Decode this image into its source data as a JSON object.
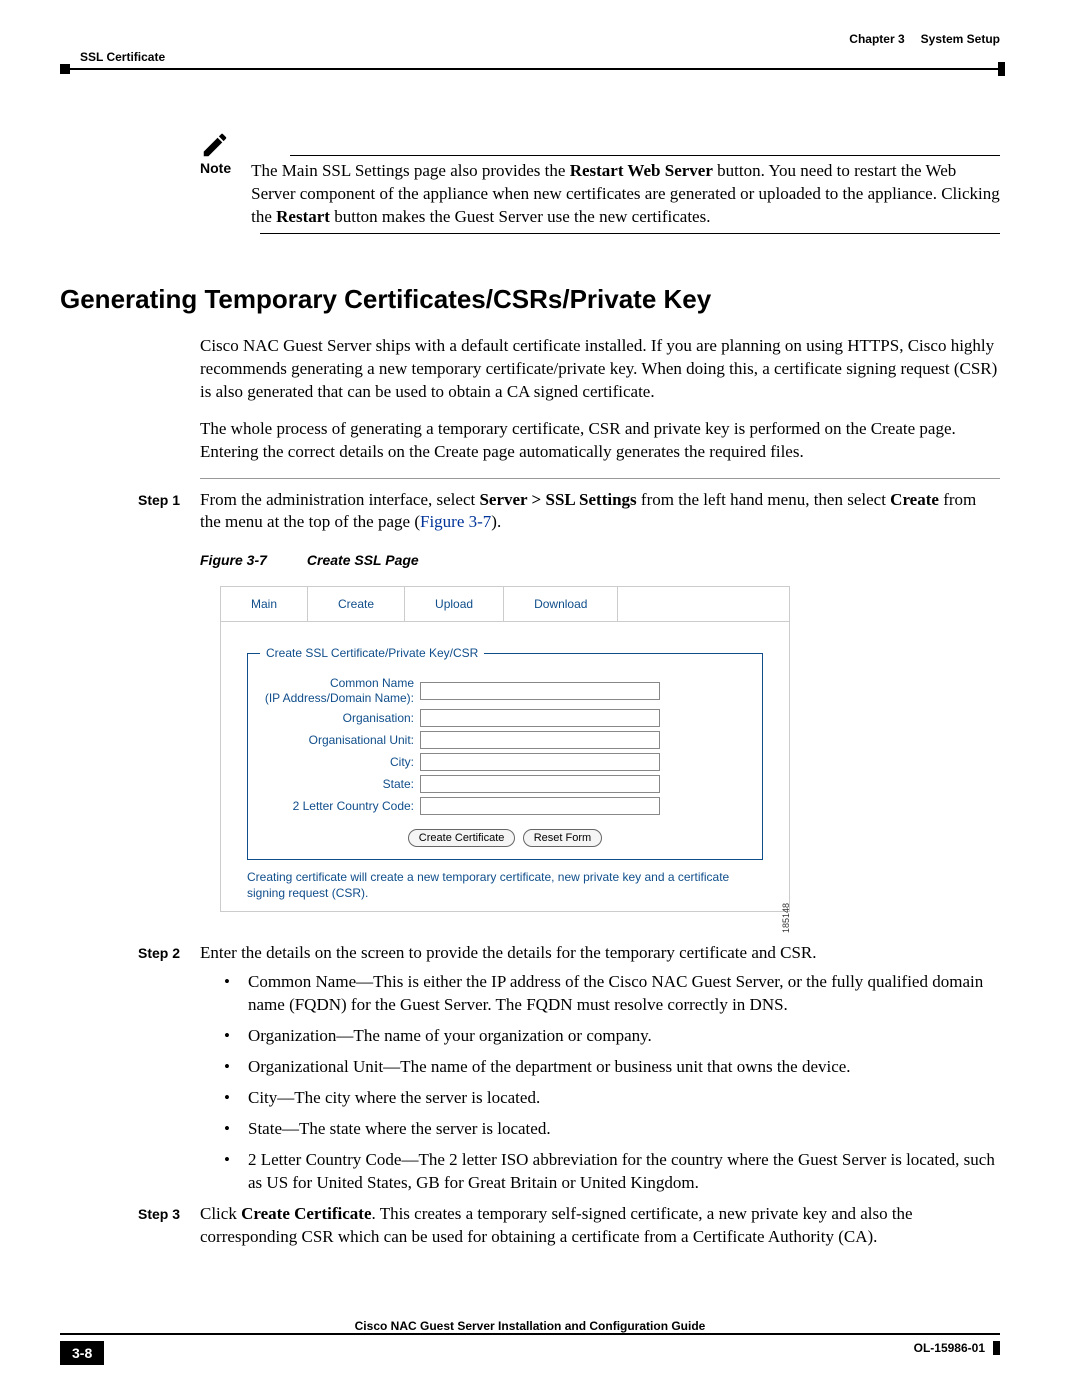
{
  "header": {
    "left": "SSL Certificate",
    "chapter": "Chapter 3",
    "chapter_title": "System Setup"
  },
  "note": {
    "label": "Note",
    "text_pre": "The Main SSL Settings page also provides the ",
    "bold1": "Restart Web Server",
    "text_mid": " button. You need to restart the Web Server component of the appliance when new certificates are generated or uploaded to the appliance. Clicking the ",
    "bold2": "Restart",
    "text_post": " button makes the Guest Server use the new certificates."
  },
  "h2": "Generating Temporary Certificates/CSRs/Private Key",
  "para1": "Cisco NAC Guest Server ships with a default certificate installed. If you are planning on using HTTPS, Cisco highly recommends generating a new temporary certificate/private key. When doing this, a certificate signing request (CSR) is also generated that can be used to obtain a CA signed certificate.",
  "para2": "The whole process of generating a temporary certificate, CSR and private key is performed on the Create page. Entering the correct details on the Create page automatically generates the required files.",
  "step1": {
    "label": "Step 1",
    "pre": "From the administration interface, select ",
    "bold1": "Server > SSL Settings",
    "mid": " from the left hand menu, then select ",
    "bold2": "Create",
    "mid2": " from the menu at the top of the page (",
    "link": "Figure 3-7",
    "post": ")."
  },
  "fig": {
    "num": "Figure 3-7",
    "title": "Create SSL Page",
    "id": "185148",
    "tabs": [
      "Main",
      "Create",
      "Upload",
      "Download"
    ],
    "legend": "Create SSL Certificate/Private Key/CSR",
    "labels": {
      "common": "Common Name",
      "common_sub": "(IP Address/Domain Name):",
      "org": "Organisation:",
      "ou": "Organisational Unit:",
      "city": "City:",
      "state": "State:",
      "cc": "2 Letter Country Code:"
    },
    "btn1": "Create Certificate",
    "btn2": "Reset Form",
    "note": "Creating certificate will create a new temporary certificate, new private key and a certificate signing request (CSR)."
  },
  "step2": {
    "label": "Step 2",
    "text": "Enter the details on the screen to provide the details for the temporary certificate and CSR."
  },
  "bullets": [
    "Common Name—This is either the IP address of the Cisco NAC Guest Server, or the fully qualified domain name (FQDN) for the Guest Server. The FQDN must resolve correctly in DNS.",
    "Organization—The name of your organization or company.",
    "Organizational Unit—The name of the department or business unit that owns the device.",
    "City—The city where the server is located.",
    "State—The state where the server is located.",
    "2 Letter Country Code—The 2 letter ISO abbreviation for the country where the Guest Server is located, such as US for United States, GB for Great Britain or United Kingdom."
  ],
  "step3": {
    "label": "Step 3",
    "pre": "Click ",
    "bold": "Create Certificate",
    "post": ". This creates a temporary self-signed certificate, a new private key and also the corresponding CSR which can be used for obtaining a certificate from a Certificate Authority (CA)."
  },
  "footer": {
    "title": "Cisco NAC Guest Server Installation and Configuration Guide",
    "page": "3-8",
    "doc": "OL-15986-01"
  }
}
